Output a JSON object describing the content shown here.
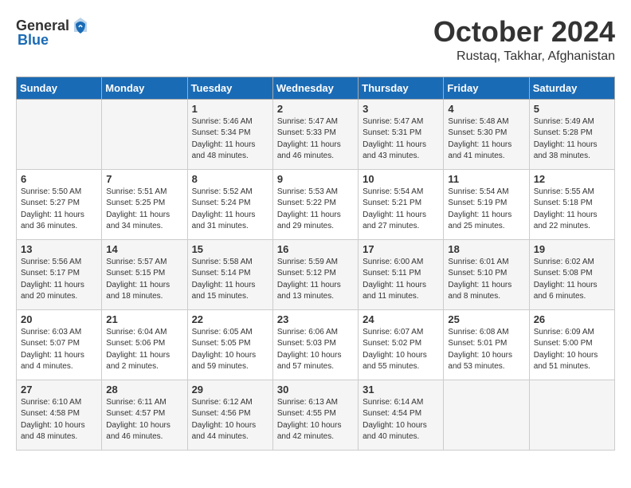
{
  "header": {
    "logo_general": "General",
    "logo_blue": "Blue",
    "month": "October 2024",
    "location": "Rustaq, Takhar, Afghanistan"
  },
  "days_of_week": [
    "Sunday",
    "Monday",
    "Tuesday",
    "Wednesday",
    "Thursday",
    "Friday",
    "Saturday"
  ],
  "weeks": [
    [
      {
        "day": "",
        "content": ""
      },
      {
        "day": "",
        "content": ""
      },
      {
        "day": "1",
        "content": "Sunrise: 5:46 AM\nSunset: 5:34 PM\nDaylight: 11 hours and 48 minutes."
      },
      {
        "day": "2",
        "content": "Sunrise: 5:47 AM\nSunset: 5:33 PM\nDaylight: 11 hours and 46 minutes."
      },
      {
        "day": "3",
        "content": "Sunrise: 5:47 AM\nSunset: 5:31 PM\nDaylight: 11 hours and 43 minutes."
      },
      {
        "day": "4",
        "content": "Sunrise: 5:48 AM\nSunset: 5:30 PM\nDaylight: 11 hours and 41 minutes."
      },
      {
        "day": "5",
        "content": "Sunrise: 5:49 AM\nSunset: 5:28 PM\nDaylight: 11 hours and 38 minutes."
      }
    ],
    [
      {
        "day": "6",
        "content": "Sunrise: 5:50 AM\nSunset: 5:27 PM\nDaylight: 11 hours and 36 minutes."
      },
      {
        "day": "7",
        "content": "Sunrise: 5:51 AM\nSunset: 5:25 PM\nDaylight: 11 hours and 34 minutes."
      },
      {
        "day": "8",
        "content": "Sunrise: 5:52 AM\nSunset: 5:24 PM\nDaylight: 11 hours and 31 minutes."
      },
      {
        "day": "9",
        "content": "Sunrise: 5:53 AM\nSunset: 5:22 PM\nDaylight: 11 hours and 29 minutes."
      },
      {
        "day": "10",
        "content": "Sunrise: 5:54 AM\nSunset: 5:21 PM\nDaylight: 11 hours and 27 minutes."
      },
      {
        "day": "11",
        "content": "Sunrise: 5:54 AM\nSunset: 5:19 PM\nDaylight: 11 hours and 25 minutes."
      },
      {
        "day": "12",
        "content": "Sunrise: 5:55 AM\nSunset: 5:18 PM\nDaylight: 11 hours and 22 minutes."
      }
    ],
    [
      {
        "day": "13",
        "content": "Sunrise: 5:56 AM\nSunset: 5:17 PM\nDaylight: 11 hours and 20 minutes."
      },
      {
        "day": "14",
        "content": "Sunrise: 5:57 AM\nSunset: 5:15 PM\nDaylight: 11 hours and 18 minutes."
      },
      {
        "day": "15",
        "content": "Sunrise: 5:58 AM\nSunset: 5:14 PM\nDaylight: 11 hours and 15 minutes."
      },
      {
        "day": "16",
        "content": "Sunrise: 5:59 AM\nSunset: 5:12 PM\nDaylight: 11 hours and 13 minutes."
      },
      {
        "day": "17",
        "content": "Sunrise: 6:00 AM\nSunset: 5:11 PM\nDaylight: 11 hours and 11 minutes."
      },
      {
        "day": "18",
        "content": "Sunrise: 6:01 AM\nSunset: 5:10 PM\nDaylight: 11 hours and 8 minutes."
      },
      {
        "day": "19",
        "content": "Sunrise: 6:02 AM\nSunset: 5:08 PM\nDaylight: 11 hours and 6 minutes."
      }
    ],
    [
      {
        "day": "20",
        "content": "Sunrise: 6:03 AM\nSunset: 5:07 PM\nDaylight: 11 hours and 4 minutes."
      },
      {
        "day": "21",
        "content": "Sunrise: 6:04 AM\nSunset: 5:06 PM\nDaylight: 11 hours and 2 minutes."
      },
      {
        "day": "22",
        "content": "Sunrise: 6:05 AM\nSunset: 5:05 PM\nDaylight: 10 hours and 59 minutes."
      },
      {
        "day": "23",
        "content": "Sunrise: 6:06 AM\nSunset: 5:03 PM\nDaylight: 10 hours and 57 minutes."
      },
      {
        "day": "24",
        "content": "Sunrise: 6:07 AM\nSunset: 5:02 PM\nDaylight: 10 hours and 55 minutes."
      },
      {
        "day": "25",
        "content": "Sunrise: 6:08 AM\nSunset: 5:01 PM\nDaylight: 10 hours and 53 minutes."
      },
      {
        "day": "26",
        "content": "Sunrise: 6:09 AM\nSunset: 5:00 PM\nDaylight: 10 hours and 51 minutes."
      }
    ],
    [
      {
        "day": "27",
        "content": "Sunrise: 6:10 AM\nSunset: 4:58 PM\nDaylight: 10 hours and 48 minutes."
      },
      {
        "day": "28",
        "content": "Sunrise: 6:11 AM\nSunset: 4:57 PM\nDaylight: 10 hours and 46 minutes."
      },
      {
        "day": "29",
        "content": "Sunrise: 6:12 AM\nSunset: 4:56 PM\nDaylight: 10 hours and 44 minutes."
      },
      {
        "day": "30",
        "content": "Sunrise: 6:13 AM\nSunset: 4:55 PM\nDaylight: 10 hours and 42 minutes."
      },
      {
        "day": "31",
        "content": "Sunrise: 6:14 AM\nSunset: 4:54 PM\nDaylight: 10 hours and 40 minutes."
      },
      {
        "day": "",
        "content": ""
      },
      {
        "day": "",
        "content": ""
      }
    ]
  ]
}
